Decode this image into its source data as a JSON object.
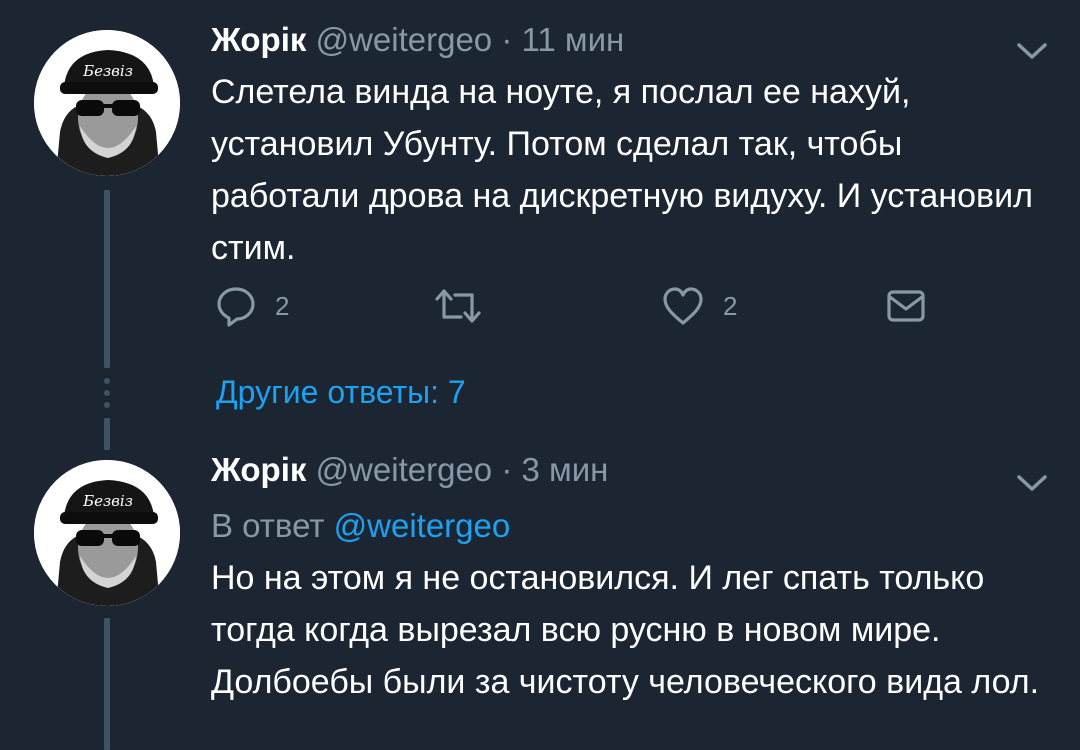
{
  "tweets": [
    {
      "author_name": "Жорік",
      "handle": "@weitergeo",
      "separator": "·",
      "time": "11 мин",
      "text": "Слетела винда на ноуте, я послал ее нахуй, установил Убунту. Потом сделал так, чтобы работали дрова на дискретную видуху. И установил стим.",
      "reply_count": "2",
      "like_count": "2",
      "avatar_cap_text": "Безвіз"
    },
    {
      "author_name": "Жорік",
      "handle": "@weitergeo",
      "separator": "·",
      "time": "3 мин",
      "reply_prefix": "В ответ",
      "reply_mention": "@weitergeo",
      "text": "Но на этом я не остановился. И лег спать только тогда когда вырезал всю русню в новом мире. Долбоебы были за чистоту человеческого вида лол.",
      "avatar_cap_text": "Безвіз"
    }
  ],
  "more_replies_label": "Другие ответы: 7",
  "icons": {
    "reply": "reply-icon",
    "retweet": "retweet-icon",
    "like": "heart-icon",
    "dm": "envelope-icon",
    "menu": "chevron-down-icon"
  },
  "colors": {
    "background": "#1c2632",
    "text": "#ffffff",
    "muted": "#8899a6",
    "accent": "#1da1f2",
    "thread_line": "#3d5466"
  }
}
